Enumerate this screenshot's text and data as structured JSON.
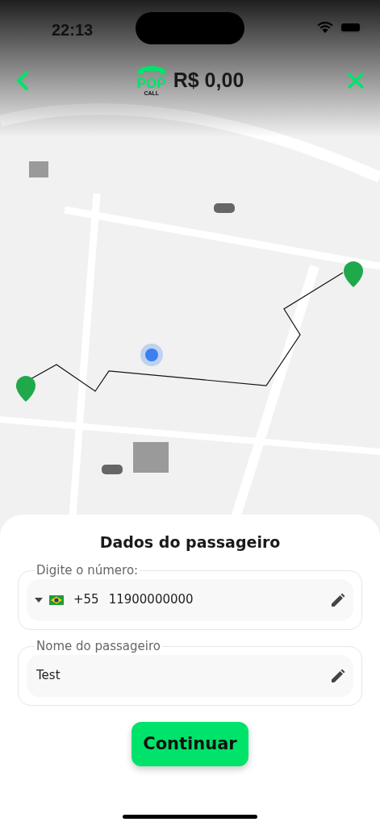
{
  "status_bar": {
    "time": "22:13"
  },
  "header": {
    "logo": {
      "top": "POP",
      "bottom": "CALL"
    },
    "fare": "R$ 0,00"
  },
  "sheet": {
    "title": "Dados do passageiro",
    "fields": [
      {
        "kind": "phone",
        "label": "Digite o número:",
        "country_code": "+55",
        "value": "11900000000"
      },
      {
        "kind": "text",
        "label": "Nome do passageiro",
        "value": "Test"
      }
    ],
    "button": "Continuar"
  }
}
